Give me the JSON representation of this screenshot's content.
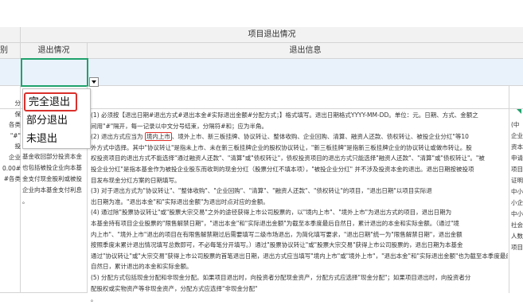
{
  "header": {
    "group_title": "项目退出情况",
    "left_col_fragment": "别",
    "col_exit_status": "退出情况",
    "col_exit_info": "退出信息"
  },
  "dropdown": {
    "options": [
      "完全退出",
      "部分退出",
      "未退出"
    ],
    "highlighted": "完全退出"
  },
  "left_col_lines": [
    "",
    "",
    "",
    "",
    "分",
    "保",
    "",
    "各类",
    "\"#\"",
    "",
    "投",
    "企业",
    "0.00#",
    "#各类"
  ],
  "mid_col_lines": [
    "基金收回部分投资本金",
    "也包括被投企业向本基",
    "金支付现金股利或被投",
    "企业向本基金支付利息",
    "。"
  ],
  "info_lines": [
    "(1) 必须按【退出日期#退出方式#退出本金#实际退出金额#分配方式；】格式填写。退出日期格式YYYY-MM-DD。单位：元。日期、方式、金额之",
    "间用\"#\"隔开，每一记录以中文分号结束，分隔符#和；应为半角。",
    "(2) 退出方式应当为 ",
    "外方式中选择。其中\"协议转让\"是指未上市、未在新三板挂牌企业的股权协议转让，\"新三板挂牌\"是指新三板挂牌企业的协议转让或做市转让。股",
    "权投资项目的退出方式不能选择\"通过融资人还款\"、\"清算\"或\"债权转让\"，债权投资项目的退出方式只能选择\"融资人还款\"、\"清算\"或\"债权转让\"。\"被",
    "投企业分红\"是指本基金作为被投企业股东而收到的现金分红（股票分红不填本项），\"被投企业分红\" 并不涉及投资本金的退出。退出日期按被投项",
    "目发布现金分红方案的日期填写。",
    "(3) 对于退出方式为\"协议转让\"、\"整体收购\"、\"企业回购\"、\"清算\"、\"融资人还款\"、\"债权转让\"的项目，\"退出日期\"以项目实际退",
    "出日期为准。\"退出本金\"和\"实际退出金额\"为退出时点对应的金额。",
    "(4) 通过除\"股票协议转让\"或\"股票大宗交易\"之外的途径获得上市公司股票的，以\"境内上市\"、\"境外上市\"为退出方式的项目，退出日期为",
    "本基金持有项目企业股票的\"限售解禁日期\"，\"退出本金\"和\"实际退出金额\"为截至本季度最后自然日，累计退出的本金和实际金额。（通过\"境",
    "内上市\"、\"境外上市\"退出的项目在有限售解禁期过后需要填写二级市场退出，为简化填写要求，\"退出日期\"统一为\"限售解禁日期\"，退出金额",
    "按照季度末累计退出情况填写总数即可，不必每笔分开填写。）通过\"股票协议转让\"或\"股票大宗交易\"获得上市公司股票的，退出日期为本基金",
    "通过\"协议转让\"或\"大宗交易\"获得上市公司股票的首笔退出日期，退出方式应当填写\"境内上市\"或\"境外上市\"，\"退出本金\"和\"实际退出金额\"也为截至本季度最后",
    "自然日，累计退出的本金和实际金额。",
    "(5) 分配方式包括现金分配和非现金分配。如果项目退出时，向投资者分配现金资产，分配方式应选择\"现金分配\"；如果项目退出时，向投资者分",
    "配股权或实物资产等非现金资产，分配方式应选择\"非现金分配\"",
    "。"
  ],
  "highlight_text": "境内上市",
  "info_line2_rest": "、境外上市、新三板挂牌、协议转让、整体收购、企业回购、清算、融资人还款、债权转让、被投企业分红\"等10",
  "right_col_lines": [
    "(中",
    "企业",
    "资本",
    "申请",
    "",
    "项目",
    "证明",
    "中小",
    "小企",
    "中小",
    "",
    "社会",
    "人数",
    "项目"
  ]
}
